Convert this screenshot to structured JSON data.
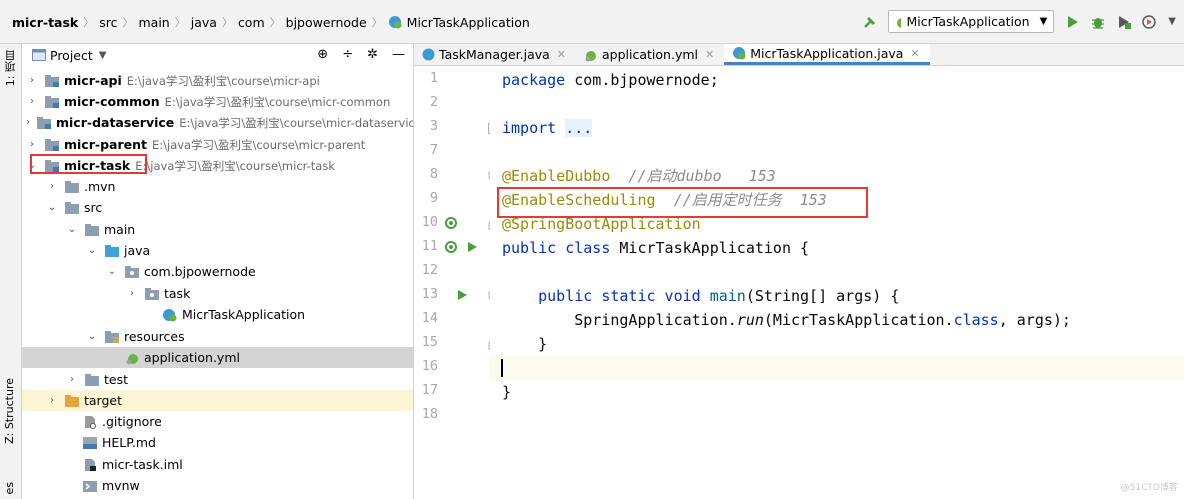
{
  "breadcrumbs": [
    "micr-task",
    "src",
    "main",
    "java",
    "com",
    "bjpowernode",
    "MicrTaskApplication"
  ],
  "run_config": {
    "label": "MicrTaskApplication"
  },
  "tool_stripe": {
    "project": "1: 项目",
    "structure": "Z: Structure",
    "bottom": "es"
  },
  "project_panel": {
    "title": "Project",
    "tree": [
      {
        "label": "micr-api",
        "path": "E:\\java学习\\盈利宝\\course\\micr-api",
        "arrow": "›",
        "icon": "module"
      },
      {
        "label": "micr-common",
        "path": "E:\\java学习\\盈利宝\\course\\micr-common",
        "arrow": "›",
        "icon": "module"
      },
      {
        "label": "micr-dataservice",
        "path": "E:\\java学习\\盈利宝\\course\\micr-dataservice",
        "arrow": "›",
        "icon": "module"
      },
      {
        "label": "micr-parent",
        "path": "E:\\java学习\\盈利宝\\course\\micr-parent",
        "arrow": "›",
        "icon": "module"
      },
      {
        "label": "micr-task",
        "path": "E:\\java学习\\盈利宝\\course\\micr-task",
        "arrow": "⌄",
        "icon": "module"
      },
      {
        "label": ".mvn",
        "path": "",
        "arrow": "›",
        "icon": "folder"
      },
      {
        "label": "src",
        "path": "",
        "arrow": "⌄",
        "icon": "folder"
      },
      {
        "label": "main",
        "path": "",
        "arrow": "⌄",
        "icon": "folder"
      },
      {
        "label": "java",
        "path": "",
        "arrow": "⌄",
        "icon": "folder-blue"
      },
      {
        "label": "com.bjpowernode",
        "path": "",
        "arrow": "⌄",
        "icon": "package"
      },
      {
        "label": "task",
        "path": "",
        "arrow": "›",
        "icon": "package"
      },
      {
        "label": "MicrTaskApplication",
        "path": "",
        "arrow": "",
        "icon": "spring-class"
      },
      {
        "label": "resources",
        "path": "",
        "arrow": "⌄",
        "icon": "resources"
      },
      {
        "label": "application.yml",
        "path": "",
        "arrow": "",
        "icon": "yml"
      },
      {
        "label": "test",
        "path": "",
        "arrow": "›",
        "icon": "folder"
      },
      {
        "label": "target",
        "path": "",
        "arrow": "›",
        "icon": "folder-orange"
      },
      {
        "label": ".gitignore",
        "path": "",
        "arrow": "",
        "icon": "file"
      },
      {
        "label": "HELP.md",
        "path": "",
        "arrow": "",
        "icon": "md"
      },
      {
        "label": "micr-task.iml",
        "path": "",
        "arrow": "",
        "icon": "iml"
      },
      {
        "label": "mvnw",
        "path": "",
        "arrow": "",
        "icon": "script"
      }
    ]
  },
  "editor": {
    "tabs": [
      {
        "label": "TaskManager.java",
        "icon": "class",
        "active": false
      },
      {
        "label": "application.yml",
        "icon": "yml",
        "active": false
      },
      {
        "label": "MicrTaskApplication.java",
        "icon": "spring-class",
        "active": true
      }
    ],
    "line_numbers": [
      "1",
      "2",
      "3",
      "7",
      "8",
      "9",
      "10",
      "11",
      "12",
      "13",
      "14",
      "15",
      "16",
      "17",
      "18"
    ],
    "code": {
      "l1_kw": "package",
      "l1_rest": " com.bjpowernode;",
      "l3_kw": "import",
      "l3_fold": "...",
      "l8_ann": "@EnableDubbo",
      "l8_comment": "  //启动dubbo   153",
      "l9_ann": "@EnableScheduling",
      "l9_comment": "  //启用定时任务  153",
      "l10_ann": "@SpringBootApplication",
      "l11_kw": "public class",
      "l11_name": " MicrTaskApplication",
      "l11_rest": " {",
      "l13_kw": "public static void",
      "l13_name": " main",
      "l13_rest": "(String[] args) {",
      "l14_a": "SpringApplication.",
      "l14_run": "run",
      "l14_b": "(MicrTaskApplication.",
      "l14_kw": "class",
      "l14_c": ", args);",
      "l15": "}",
      "l17": "}"
    }
  },
  "watermark": "@51CTO博客",
  "colors": {
    "keyword": "#0033b3",
    "annotation": "#9e880d",
    "comment": "#8c8c8c",
    "highlight_box": "#e53935",
    "tab_underline": "#4083c9"
  }
}
